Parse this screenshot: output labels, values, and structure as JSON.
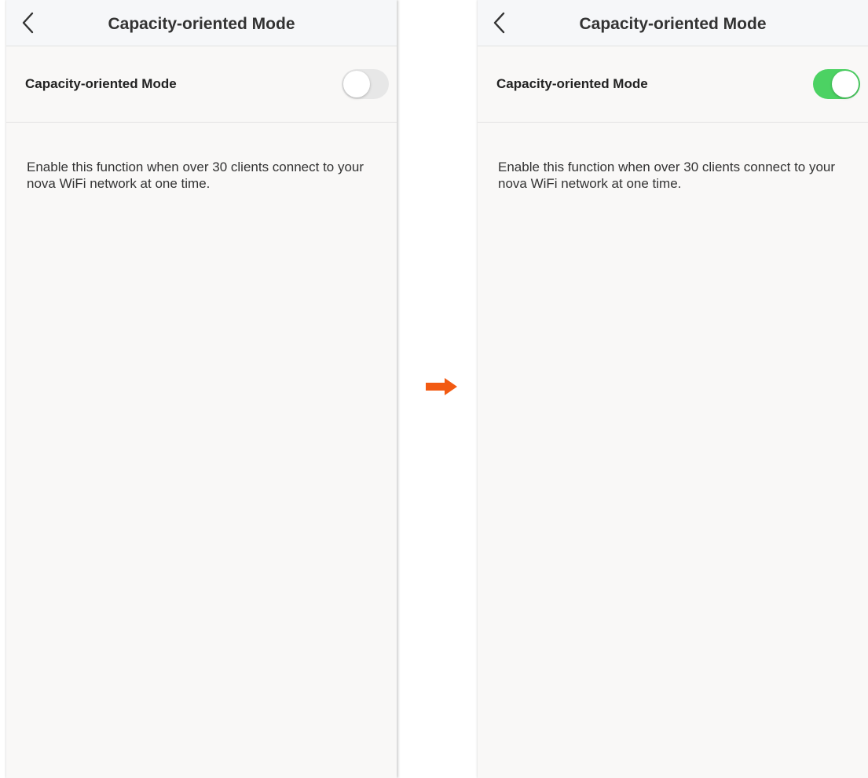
{
  "screens": [
    {
      "nav": {
        "title": "Capacity-oriented Mode"
      },
      "setting": {
        "label": "Capacity-oriented Mode",
        "enabled": false
      },
      "description": "Enable this function when over 30 clients connect to your nova WiFi network at one time."
    },
    {
      "nav": {
        "title": "Capacity-oriented Mode"
      },
      "setting": {
        "label": "Capacity-oriented Mode",
        "enabled": true
      },
      "description": "Enable this function when over 30 clients connect to your nova WiFi network at one time."
    }
  ],
  "colors": {
    "toggle_on": "#4cd263",
    "toggle_off": "#e7e7e7",
    "arrow": "#f25a12",
    "background": "#f9f8f7"
  },
  "icons": {
    "back": "chevron-left-icon",
    "transition": "arrow-right-icon"
  }
}
